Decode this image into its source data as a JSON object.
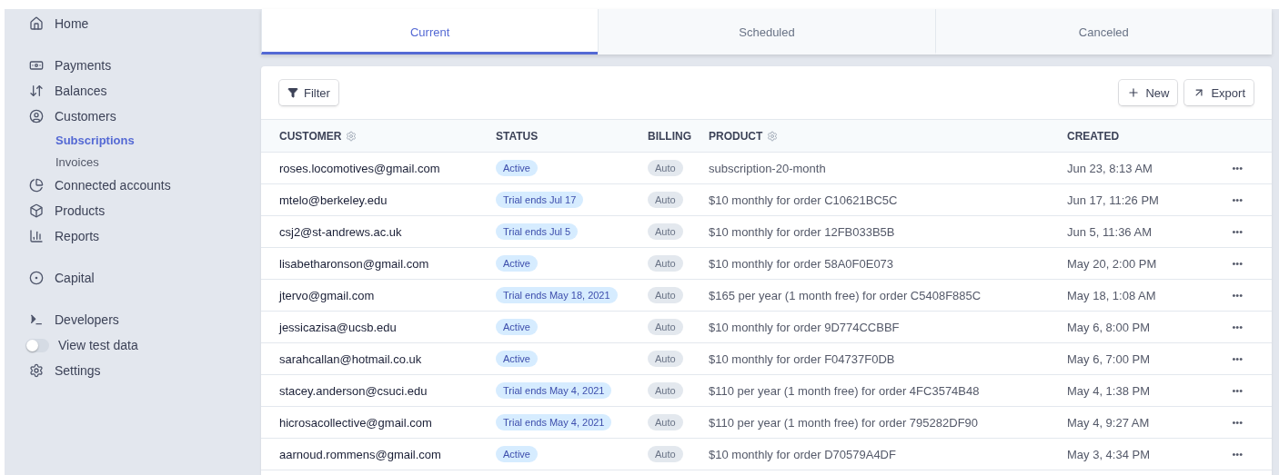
{
  "sidebar": {
    "groups": [
      [
        {
          "label": "Home",
          "selected": false
        }
      ],
      [
        {
          "label": "Payments",
          "selected": false
        },
        {
          "label": "Balances",
          "selected": false
        },
        {
          "label": "Customers",
          "selected": false,
          "children": [
            {
              "label": "Subscriptions",
              "selected": true
            },
            {
              "label": "Invoices",
              "selected": false
            }
          ]
        },
        {
          "label": "Connected accounts",
          "selected": false
        },
        {
          "label": "Products",
          "selected": false
        },
        {
          "label": "Reports",
          "selected": false
        }
      ],
      [
        {
          "label": "Capital",
          "selected": false
        }
      ],
      [
        {
          "label": "Developers",
          "selected": false,
          "kind": "link"
        },
        {
          "label": "View test data",
          "kind": "toggle",
          "on": false
        },
        {
          "label": "Settings",
          "selected": false,
          "kind": "link"
        }
      ]
    ]
  },
  "tabs": [
    {
      "label": "Current",
      "selected": true
    },
    {
      "label": "Scheduled",
      "selected": false
    },
    {
      "label": "Canceled",
      "selected": false
    }
  ],
  "toolbar": {
    "filter": "Filter",
    "new": "New",
    "export": "Export"
  },
  "table": {
    "columns": [
      {
        "label": "CUSTOMER",
        "settings": true
      },
      {
        "label": "STATUS",
        "settings": false
      },
      {
        "label": "BILLING",
        "settings": false
      },
      {
        "label": "PRODUCT",
        "settings": true
      },
      {
        "label": "CREATED",
        "settings": false
      }
    ],
    "rows": [
      {
        "customer": "roses.locomotives@gmail.com",
        "status": "Active",
        "billing": "Auto",
        "product": "subscription-20-month",
        "created": "Jun 23, 8:13 AM",
        "more": "•••"
      },
      {
        "customer": "mtelo@berkeley.edu",
        "status": "Trial ends Jul 17",
        "billing": "Auto",
        "product": "$10 monthly for order C10621BC5C",
        "created": "Jun 17, 11:26 PM",
        "more": "•••"
      },
      {
        "customer": "csj2@st-andrews.ac.uk",
        "status": "Trial ends Jul 5",
        "billing": "Auto",
        "product": "$10 monthly for order 12FB033B5B",
        "created": "Jun 5, 11:36 AM",
        "more": "•••"
      },
      {
        "customer": "lisabetharonson@gmail.com",
        "status": "Active",
        "billing": "Auto",
        "product": "$10 monthly for order 58A0F0E073",
        "created": "May 20, 2:00 PM",
        "more": "•••"
      },
      {
        "customer": "jtervo@gmail.com",
        "status": "Trial ends May 18, 2021",
        "billing": "Auto",
        "product": "$165 per year (1 month free) for order C5408F885C",
        "created": "May 18, 1:08 AM",
        "more": "•••"
      },
      {
        "customer": "jessicazisa@ucsb.edu",
        "status": "Active",
        "billing": "Auto",
        "product": "$10 monthly for order 9D774CCBBF",
        "created": "May 6, 8:00 PM",
        "more": "•••"
      },
      {
        "customer": "sarahcallan@hotmail.co.uk",
        "status": "Active",
        "billing": "Auto",
        "product": "$10 monthly for order F04737F0DB",
        "created": "May 6, 7:00 PM",
        "more": "•••"
      },
      {
        "customer": "stacey.anderson@csuci.edu",
        "status": "Trial ends May 4, 2021",
        "billing": "Auto",
        "product": "$110 per year (1 month free) for order 4FC3574B48",
        "created": "May 4, 1:38 PM",
        "more": "•••"
      },
      {
        "customer": "hicrosacollective@gmail.com",
        "status": "Trial ends May 4, 2021",
        "billing": "Auto",
        "product": "$110 per year (1 month free) for order 795282DF90",
        "created": "May 4, 9:27 AM",
        "more": "•••"
      },
      {
        "customer": "aarnoud.rommens@gmail.com",
        "status": "Active",
        "billing": "Auto",
        "product": "$10 monthly for order D70579A4DF",
        "created": "May 3, 4:34 PM",
        "more": "•••"
      }
    ]
  }
}
